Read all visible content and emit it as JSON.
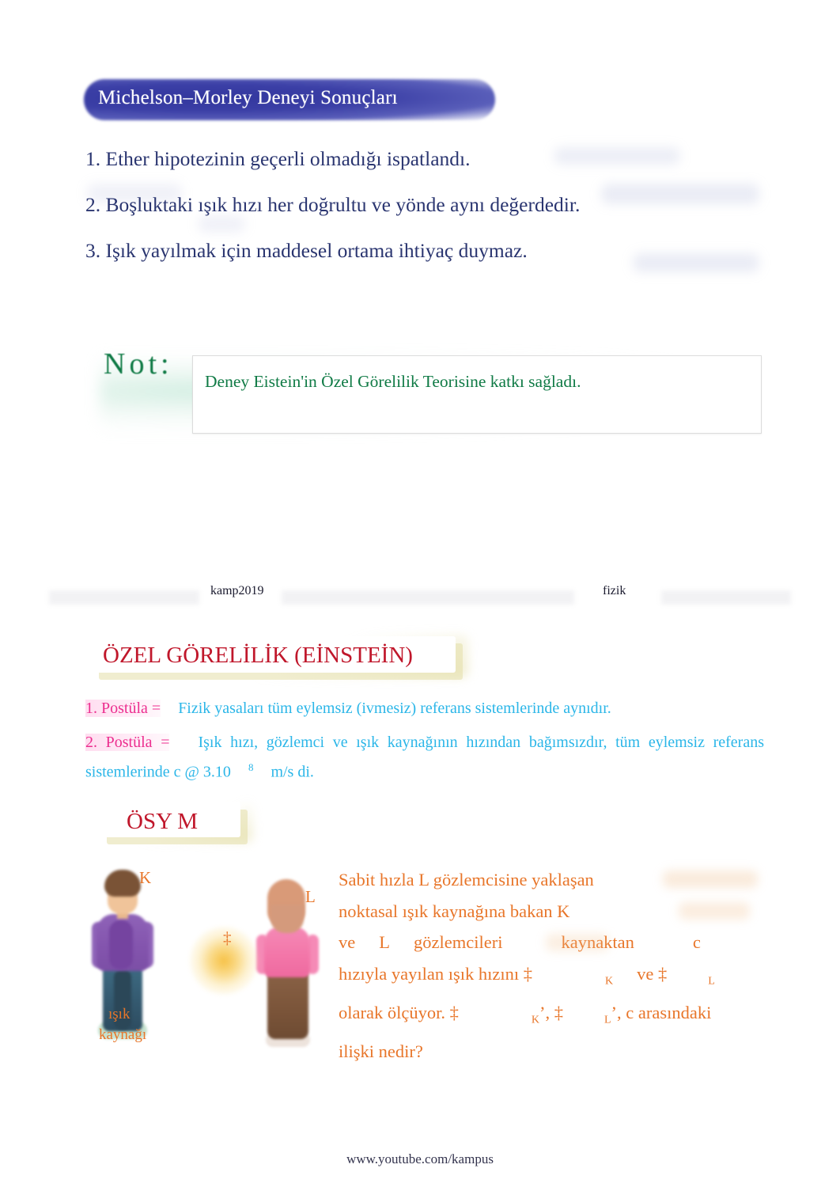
{
  "document": {
    "footer_url": "www.youtube.com/kampus"
  },
  "slide1": {
    "title": "Michelson–Morley Deneyi Sonuçları",
    "results": [
      "1.  Ether  hipotezinin  geçerli  olmadığı  ispatlandı.",
      "2.  Boşluktaki  ışık  hızı  her  doğrultu  ve  yönde  aynı  değerdedir.",
      "3.  Işık  yayılmak  için  maddesel  ortama  ihtiyaç  duymaz."
    ],
    "note": {
      "label": "Not:",
      "text": "Deney Eistein'in Özel Görelilik Teorisine katkı sağladı."
    },
    "separator": {
      "left_label": "kamp2019",
      "right_label": "fizik"
    }
  },
  "slide2": {
    "heading_main": "ÖZEL GÖRELİLİK (EİNSTEİN)",
    "heading_sub": "ÖSY  M",
    "postulate1": {
      "number": "1.  Postüla  =",
      "text": "Fizik  yasaları  tüm  eylemsiz  (ivmesiz)  referans  sistemlerinde  aynıdır."
    },
    "postulate2": {
      "number": "2.  Postüla  =",
      "text_part1": "Işık  hızı,  gözlemci  ve  ışık  kaynağının  hızından  bağımsızdır,  tüm  eylemsiz  referans  sistemlerinde  c  @  3.10",
      "exponent": "8",
      "text_part2": "m/s  di."
    },
    "figure": {
      "label_k": "K",
      "label_l": "L",
      "dagger": "‡",
      "source_line1": "ışık",
      "source_line2": "kaynağı"
    },
    "question": {
      "line1": "Sabit hızla L gözlemcisine yaklaşan",
      "line2": "noktasal  ışık  kaynağına  bakan  K",
      "line3_a": "ve",
      "line3_b": "L",
      "line3_c": "gözlemcileri",
      "line3_d": "kaynaktan",
      "line3_e": "c",
      "line4_a": "hızıyla  yayılan  ışık  hızını  ‡",
      "line4_sub1": "K",
      "line4_b": "ve  ‡",
      "line4_sub2": "L",
      "line5_a": "olarak ölçüyor. ‡",
      "line5_sub1": "K",
      "line5_b": "’,  ‡",
      "line5_sub2": "L",
      "line5_c": "’,  c  arasındaki",
      "line6": "ilişki  nedir?"
    }
  },
  "colors": {
    "title_banner": "#3b3fa6",
    "list_blue": "#2a3570",
    "note_green": "#0f7a45",
    "heading_red": "#c0172b",
    "postulate_cyan": "#2bb6e8",
    "postulate_magenta": "#ec2e8f",
    "question_orange": "#e8762a"
  }
}
